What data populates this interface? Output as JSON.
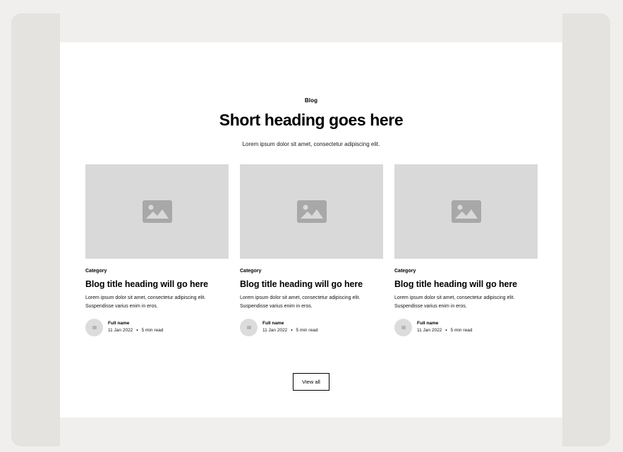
{
  "section": {
    "eyebrow": "Blog",
    "heading": "Short heading goes here",
    "subheading": "Lorem ipsum dolor sit amet, consectetur adipiscing elit."
  },
  "cards": [
    {
      "category": "Category",
      "title": "Blog title heading will go here",
      "description": "Lorem ipsum dolor sit amet, consectetur adipiscing elit. Suspendisse varius enim in eros.",
      "author": "Full name",
      "date": "11 Jan 2022",
      "read_time": "5 min read",
      "image_icon": "image-placeholder-icon"
    },
    {
      "category": "Category",
      "title": "Blog title heading will go here",
      "description": "Lorem ipsum dolor sit amet, consectetur adipiscing elit. Suspendisse varius enim in eros.",
      "author": "Full name",
      "date": "11 Jan 2022",
      "read_time": "5 min read",
      "image_icon": "image-placeholder-icon"
    },
    {
      "category": "Category",
      "title": "Blog title heading will go here",
      "description": "Lorem ipsum dolor sit amet, consectetur adipiscing elit. Suspendisse varius enim in eros.",
      "author": "Full name",
      "date": "11 Jan 2022",
      "read_time": "5 min read",
      "image_icon": "image-placeholder-icon"
    }
  ],
  "meta_separator": "•",
  "view_all_label": "View all",
  "colors": {
    "background": "#f0efed",
    "frame": "#e4e3df",
    "section": "#ffffff",
    "placeholder": "#d9d9d9",
    "placeholder_icon": "#a8a8a8"
  }
}
